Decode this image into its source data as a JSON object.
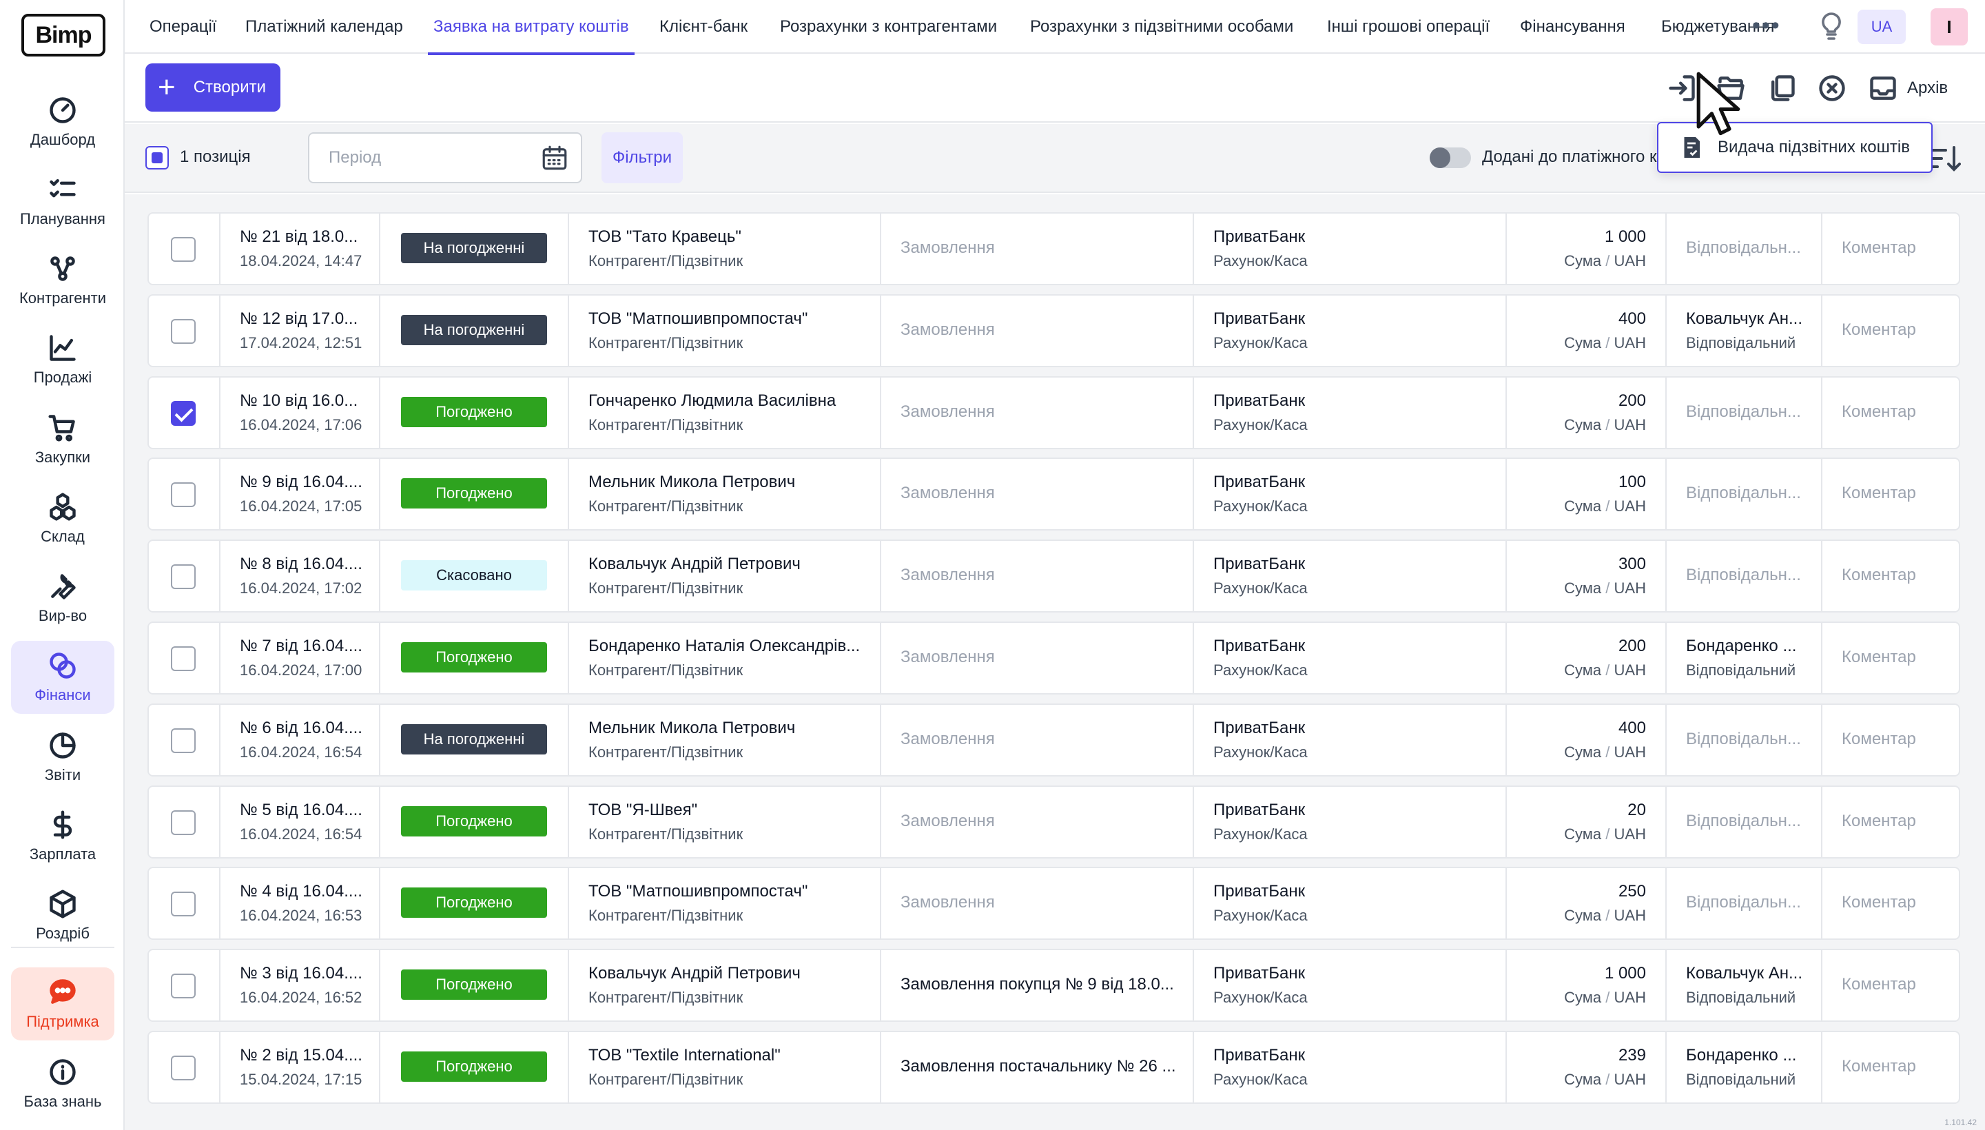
{
  "app": {
    "logo": "Bimp",
    "version": "1.101.42"
  },
  "sidebar": {
    "items": [
      {
        "label": "Дашборд",
        "icon": "gauge-icon"
      },
      {
        "label": "Планування",
        "icon": "checklist-icon"
      },
      {
        "label": "Контрагенти",
        "icon": "network-icon"
      },
      {
        "label": "Продажі",
        "icon": "chart-line-icon"
      },
      {
        "label": "Закупки",
        "icon": "cart-icon"
      },
      {
        "label": "Склад",
        "icon": "boxes-icon"
      },
      {
        "label": "Вир-во",
        "icon": "wrench-icon"
      },
      {
        "label": "Фінанси",
        "icon": "coins-icon"
      },
      {
        "label": "Звіти",
        "icon": "pie-chart-icon"
      },
      {
        "label": "Зарплата",
        "icon": "dollar-icon"
      },
      {
        "label": "Роздріб",
        "icon": "cube-icon"
      }
    ],
    "support": {
      "label": "Підтримка",
      "icon": "chat-icon"
    },
    "knowledge": {
      "label": "База знань",
      "icon": "info-icon"
    }
  },
  "tabs": [
    "Операції",
    "Платіжний календар",
    "Заявка на витрату коштів",
    "Клієнт-банк",
    "Розрахунки з контрагентами",
    "Розрахунки з підзвітними особами",
    "Інші грошові операції",
    "Фінансування",
    "Бюджетування"
  ],
  "header": {
    "lang": "UA",
    "user_initial": "I"
  },
  "toolbar": {
    "create_label": "Створити",
    "archive_label": "Архів"
  },
  "filters": {
    "selected_count": "1 позиція",
    "period_placeholder": "Період",
    "filters_label": "Фільтри",
    "toggle_label": "Додані до платіжного календаря"
  },
  "dropdown": {
    "item_label": "Видача підзвітних коштів"
  },
  "colors": {
    "accent": "#4f46e5",
    "approved": "#2ea31f",
    "pending": "#374151",
    "cancelled": "#dbf8fc"
  },
  "table": {
    "rows": [
      {
        "number": "№ 21 від 18.0...",
        "date": "18.04.2024, 14:47",
        "status": "На погодженні",
        "status_type": "pending",
        "counterparty": "ТОВ \"Тато Кравець\"",
        "counterparty_sub": "Контрагент/Підзвітник",
        "order": "Замовлення",
        "order_muted": true,
        "bank": "ПриватБанк",
        "bank_sub": "Рахунок/Каса",
        "amount": "1 000",
        "amount_sub_a": "Сума",
        "amount_sub_b": "UAH",
        "resp": "Відповідальн...",
        "resp_sub": "",
        "comment": "Коментар",
        "checked": false
      },
      {
        "number": "№ 12 від 17.0...",
        "date": "17.04.2024, 12:51",
        "status": "На погодженні",
        "status_type": "pending",
        "counterparty": "ТОВ \"Матпошивпромпостач\"",
        "counterparty_sub": "Контрагент/Підзвітник",
        "order": "Замовлення",
        "order_muted": true,
        "bank": "ПриватБанк",
        "bank_sub": "Рахунок/Каса",
        "amount": "400",
        "amount_sub_a": "Сума",
        "amount_sub_b": "UAH",
        "resp": "Ковальчук Ан...",
        "resp_sub": "Відповідальний",
        "comment": "Коментар",
        "checked": false
      },
      {
        "number": "№ 10 від 16.0...",
        "date": "16.04.2024, 17:06",
        "status": "Погоджено",
        "status_type": "approved",
        "counterparty": "Гончаренко Людмила Василівна",
        "counterparty_sub": "Контрагент/Підзвітник",
        "order": "Замовлення",
        "order_muted": true,
        "bank": "ПриватБанк",
        "bank_sub": "Рахунок/Каса",
        "amount": "200",
        "amount_sub_a": "Сума",
        "amount_sub_b": "UAH",
        "resp": "Відповідальн...",
        "resp_sub": "",
        "comment": "Коментар",
        "checked": true
      },
      {
        "number": "№ 9 від 16.04....",
        "date": "16.04.2024, 17:05",
        "status": "Погоджено",
        "status_type": "approved",
        "counterparty": "Мельник Микола Петрович",
        "counterparty_sub": "Контрагент/Підзвітник",
        "order": "Замовлення",
        "order_muted": true,
        "bank": "ПриватБанк",
        "bank_sub": "Рахунок/Каса",
        "amount": "100",
        "amount_sub_a": "Сума",
        "amount_sub_b": "UAH",
        "resp": "Відповідальн...",
        "resp_sub": "",
        "comment": "Коментар",
        "checked": false
      },
      {
        "number": "№ 8 від 16.04....",
        "date": "16.04.2024, 17:02",
        "status": "Скасовано",
        "status_type": "cancelled",
        "counterparty": "Ковальчук Андрій Петрович",
        "counterparty_sub": "Контрагент/Підзвітник",
        "order": "Замовлення",
        "order_muted": true,
        "bank": "ПриватБанк",
        "bank_sub": "Рахунок/Каса",
        "amount": "300",
        "amount_sub_a": "Сума",
        "amount_sub_b": "UAH",
        "resp": "Відповідальн...",
        "resp_sub": "",
        "comment": "Коментар",
        "checked": false
      },
      {
        "number": "№ 7 від 16.04....",
        "date": "16.04.2024, 17:00",
        "status": "Погоджено",
        "status_type": "approved",
        "counterparty": "Бондаренко Наталія Олександрів...",
        "counterparty_sub": "Контрагент/Підзвітник",
        "order": "Замовлення",
        "order_muted": true,
        "bank": "ПриватБанк",
        "bank_sub": "Рахунок/Каса",
        "amount": "200",
        "amount_sub_a": "Сума",
        "amount_sub_b": "UAH",
        "resp": "Бондаренко ...",
        "resp_sub": "Відповідальний",
        "comment": "Коментар",
        "checked": false
      },
      {
        "number": "№ 6 від 16.04....",
        "date": "16.04.2024, 16:54",
        "status": "На погодженні",
        "status_type": "pending",
        "counterparty": "Мельник Микола Петрович",
        "counterparty_sub": "Контрагент/Підзвітник",
        "order": "Замовлення",
        "order_muted": true,
        "bank": "ПриватБанк",
        "bank_sub": "Рахунок/Каса",
        "amount": "400",
        "amount_sub_a": "Сума",
        "amount_sub_b": "UAH",
        "resp": "Відповідальн...",
        "resp_sub": "",
        "comment": "Коментар",
        "checked": false
      },
      {
        "number": "№ 5 від 16.04....",
        "date": "16.04.2024, 16:54",
        "status": "Погоджено",
        "status_type": "approved",
        "counterparty": "ТОВ \"Я-Швея\"",
        "counterparty_sub": "Контрагент/Підзвітник",
        "order": "Замовлення",
        "order_muted": true,
        "bank": "ПриватБанк",
        "bank_sub": "Рахунок/Каса",
        "amount": "20",
        "amount_sub_a": "Сума",
        "amount_sub_b": "UAH",
        "resp": "Відповідальн...",
        "resp_sub": "",
        "comment": "Коментар",
        "checked": false
      },
      {
        "number": "№ 4 від 16.04....",
        "date": "16.04.2024, 16:53",
        "status": "Погоджено",
        "status_type": "approved",
        "counterparty": "ТОВ \"Матпошивпромпостач\"",
        "counterparty_sub": "Контрагент/Підзвітник",
        "order": "Замовлення",
        "order_muted": true,
        "bank": "ПриватБанк",
        "bank_sub": "Рахунок/Каса",
        "amount": "250",
        "amount_sub_a": "Сума",
        "amount_sub_b": "UAH",
        "resp": "Відповідальн...",
        "resp_sub": "",
        "comment": "Коментар",
        "checked": false
      },
      {
        "number": "№ 3 від 16.04....",
        "date": "16.04.2024, 16:52",
        "status": "Погоджено",
        "status_type": "approved",
        "counterparty": "Ковальчук Андрій Петрович",
        "counterparty_sub": "Контрагент/Підзвітник",
        "order": "Замовлення покупця № 9 від 18.0...",
        "order_muted": false,
        "bank": "ПриватБанк",
        "bank_sub": "Рахунок/Каса",
        "amount": "1 000",
        "amount_sub_a": "Сума",
        "amount_sub_b": "UAH",
        "resp": "Ковальчук Ан...",
        "resp_sub": "Відповідальний",
        "comment": "Коментар",
        "checked": false
      },
      {
        "number": "№ 2 від 15.04....",
        "date": "15.04.2024, 17:15",
        "status": "Погоджено",
        "status_type": "approved",
        "counterparty": "ТОВ \"Textile International\"",
        "counterparty_sub": "Контрагент/Підзвітник",
        "order": "Замовлення постачальнику № 26 ...",
        "order_muted": false,
        "bank": "ПриватБанк",
        "bank_sub": "Рахунок/Каса",
        "amount": "239",
        "amount_sub_a": "Сума",
        "amount_sub_b": "UAH",
        "resp": "Бондаренко ...",
        "resp_sub": "Відповідальний",
        "comment": "Коментар",
        "checked": false
      }
    ]
  }
}
